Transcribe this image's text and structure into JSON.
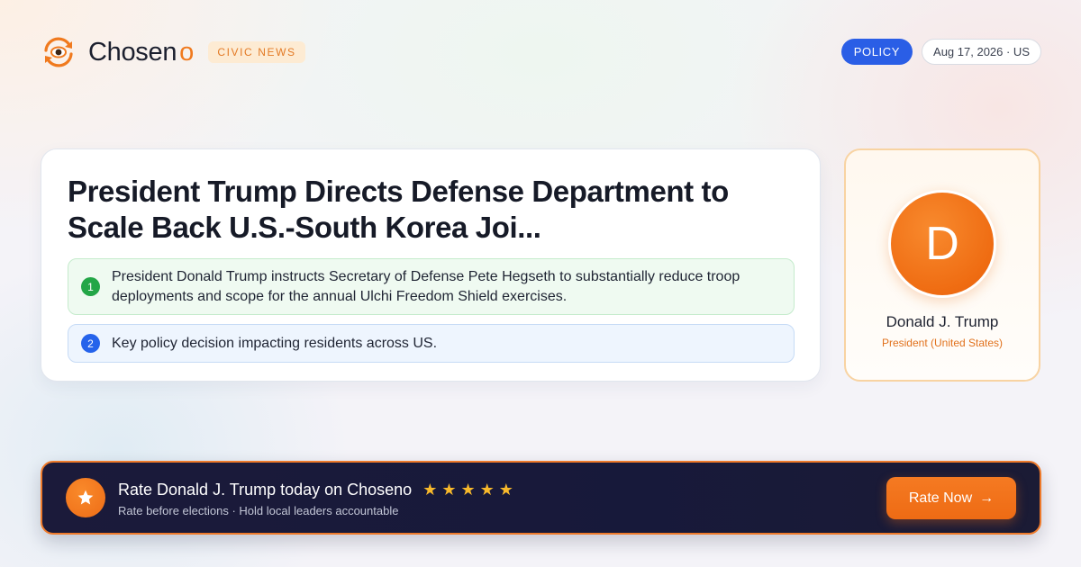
{
  "header": {
    "brand_name": "Chosen",
    "brand_suffix": "o",
    "section_badge": "CIVIC NEWS",
    "category": "POLICY",
    "date_location": "Aug 17, 2026 · US"
  },
  "article": {
    "title": "President Trump Directs Defense Department to Scale Back U.S.-South Korea Joi...",
    "points": [
      {
        "number": "1",
        "text": "President Donald Trump instructs Secretary of Defense Pete Hegseth to substantially reduce troop deployments and scope for the annual Ulchi Freedom Shield exercises."
      },
      {
        "number": "2",
        "text": "Key policy decision impacting residents across US."
      }
    ]
  },
  "person": {
    "initial": "D",
    "name": "Donald J. Trump",
    "role": "President (United States)"
  },
  "cta": {
    "title": "Rate Donald J. Trump today on Choseno",
    "stars": "★★★★★",
    "rating_stars": 5,
    "subtitle": "Rate before elections · Hold local leaders accountable",
    "button_label": "Rate Now",
    "button_arrow": "→"
  },
  "colors": {
    "accent": "#f07a1e",
    "policy_blue": "#2a5ee6",
    "cta_background": "#1b1a3a",
    "star_gold": "#f8b92b"
  },
  "icons": {
    "logo": "eye-refresh-icon",
    "cta": "star-icon",
    "button": "arrow-right-icon"
  }
}
